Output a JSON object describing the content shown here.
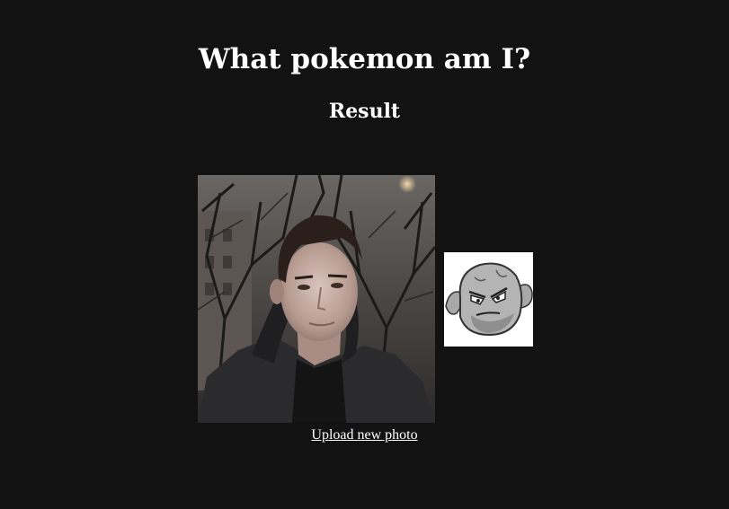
{
  "header": {
    "title": "What pokemon am I?",
    "subtitle": "Result"
  },
  "result": {
    "user_photo_icon": "portrait-photo",
    "pokemon_image_icon": "geodude-pokemon"
  },
  "actions": {
    "upload_label": "Upload new photo"
  },
  "colors": {
    "background": "#121212",
    "text": "#ffffff"
  }
}
